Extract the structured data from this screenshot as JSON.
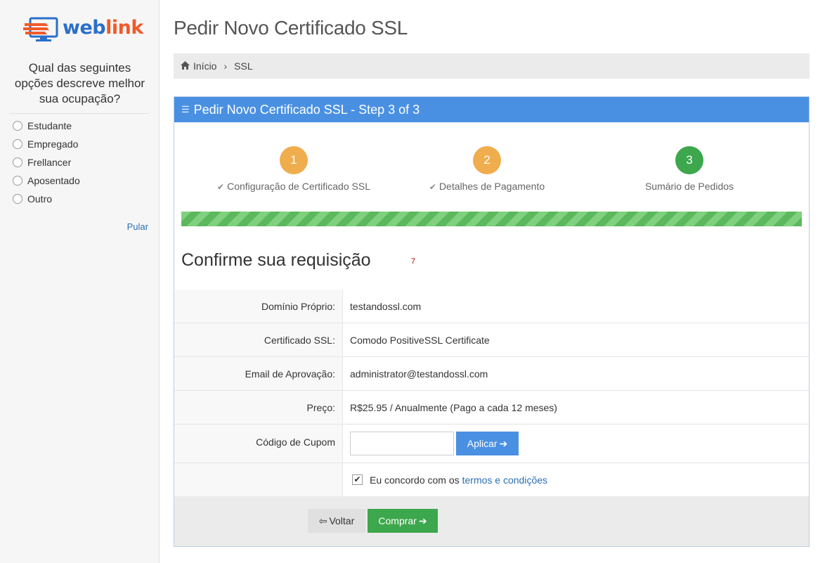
{
  "logo": {
    "part1": "web",
    "part2": "link"
  },
  "survey": {
    "question": "Qual das seguintes opções descreve melhor sua ocupação?",
    "options": [
      "Estudante",
      "Empregado",
      "Frellancer",
      "Aposentado",
      "Outro"
    ],
    "skip": "Pular"
  },
  "page_title": "Pedir Novo Certificado SSL",
  "breadcrumb": {
    "home": "Início",
    "current": "SSL"
  },
  "panel": {
    "title": "Pedir Novo Certificado SSL - Step 3 of 3",
    "steps": [
      {
        "num": "1",
        "label": "Configuração de Certificado SSL",
        "color": "#f0ad4e",
        "done": true
      },
      {
        "num": "2",
        "label": "Detalhes de Pagamento",
        "color": "#f0ad4e",
        "done": true
      },
      {
        "num": "3",
        "label": "Sumário de Pedidos",
        "color": "#3ca74c",
        "done": false
      }
    ],
    "progress": 1.0,
    "confirm_title": "Confirme sua requisição",
    "marker": "7",
    "fields": {
      "domain_label": "Domínio Próprio:",
      "domain_value": "testandossl.com",
      "cert_label": "Certificado SSL:",
      "cert_value": "Comodo PositiveSSL Certificate",
      "email_label": "Email de Aprovação:",
      "email_value": "administrator@testandossl.com",
      "price_label": "Preço:",
      "price_value": "R$25.95 / Anualmente (Pago a cada 12 meses)",
      "coupon_label": "Código de Cupom",
      "coupon_value": "",
      "apply_label": "Aplicar"
    },
    "terms": {
      "text": "Eu concordo com os",
      "link": "termos e condições",
      "checked": true
    },
    "buttons": {
      "back": "Voltar",
      "buy": "Comprar"
    }
  },
  "colors": {
    "primary": "#4a90e2",
    "success": "#3ca74c",
    "warning": "#f0ad4e",
    "logo_blue": "#2a6fc9",
    "logo_orange": "#f15a29"
  }
}
